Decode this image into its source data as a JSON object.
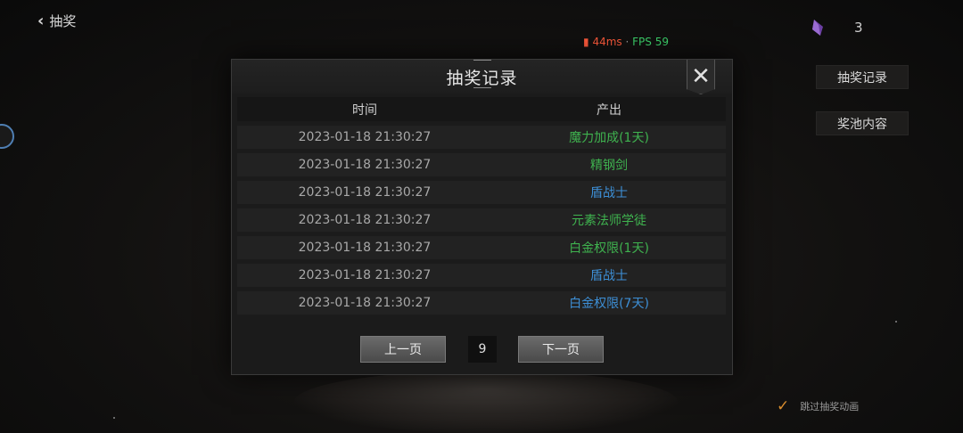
{
  "header": {
    "back_label": "抽奖"
  },
  "network": {
    "latency": "44ms",
    "separator": "·",
    "fps": "FPS 59"
  },
  "currency": {
    "icon": "purple-crystal-icon",
    "count": "3"
  },
  "side_buttons": {
    "records": "抽奖记录",
    "pool": "奖池内容"
  },
  "skip_animation": {
    "label": "跳过抽奖动画",
    "checked": true
  },
  "modal": {
    "title": "抽奖记录",
    "columns": {
      "time": "时间",
      "output": "产出"
    },
    "rows": [
      {
        "time": "2023-01-18 21:30:27",
        "item": "魔力加成(1天)",
        "color": "#3fb34f"
      },
      {
        "time": "2023-01-18 21:30:27",
        "item": "精钢剑",
        "color": "#3fb34f"
      },
      {
        "time": "2023-01-18 21:30:27",
        "item": "盾战士",
        "color": "#3d8fd6"
      },
      {
        "time": "2023-01-18 21:30:27",
        "item": "元素法师学徒",
        "color": "#3fb34f"
      },
      {
        "time": "2023-01-18 21:30:27",
        "item": "白金权限(1天)",
        "color": "#3fb34f"
      },
      {
        "time": "2023-01-18 21:30:27",
        "item": "盾战士",
        "color": "#3d8fd6"
      },
      {
        "time": "2023-01-18 21:30:27",
        "item": "白金权限(7天)",
        "color": "#3d8fd6"
      }
    ],
    "pager": {
      "prev": "上一页",
      "page": "9",
      "next": "下一页"
    }
  }
}
